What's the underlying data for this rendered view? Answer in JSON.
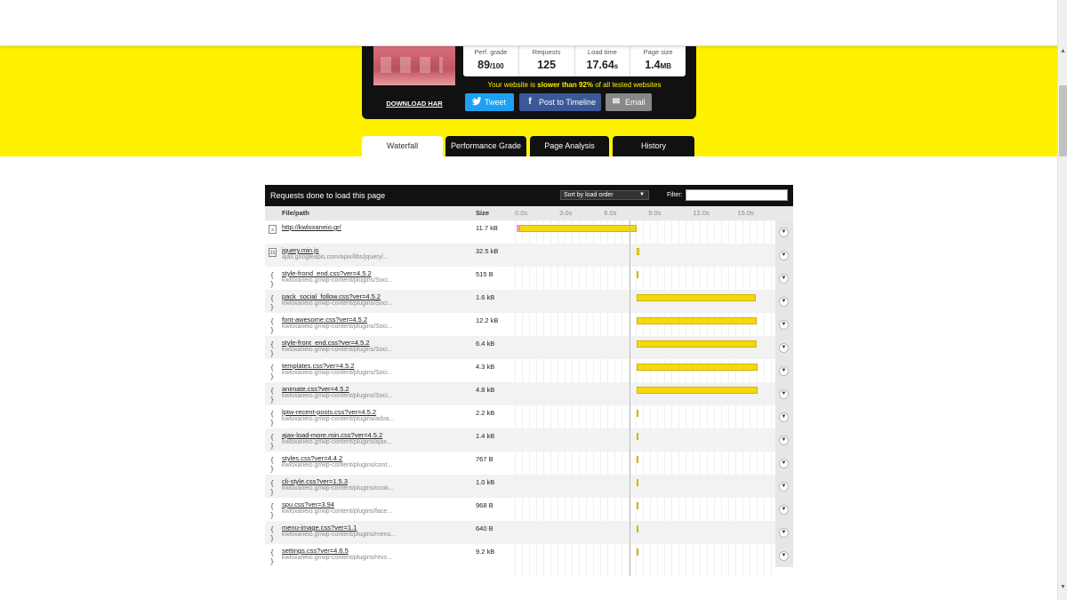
{
  "summary": {
    "download_har": "DOWNLOAD HAR",
    "metrics": [
      {
        "label": "Perf. grade",
        "value": "89",
        "unit": "/100"
      },
      {
        "label": "Requests",
        "value": "125",
        "unit": ""
      },
      {
        "label": "Load time",
        "value": "17.64",
        "unit": "s"
      },
      {
        "label": "Page size",
        "value": "1.4",
        "unit": "MB"
      }
    ],
    "slower_prefix": "Your website is ",
    "slower_bold": "slower than 92%",
    "slower_suffix": " of all tested websites",
    "share": {
      "tweet": "Tweet",
      "facebook": "Post to Timeline",
      "email": "Email"
    }
  },
  "tabs": [
    {
      "label": "Waterfall",
      "active": true
    },
    {
      "label": "Performance Grade",
      "active": false
    },
    {
      "label": "Page Analysis",
      "active": false
    },
    {
      "label": "History",
      "active": false
    }
  ],
  "waterfall": {
    "title": "Requests done to load this page",
    "sort_value": "Sort by load order",
    "filter_label": "Filter:",
    "filter_value": "",
    "col_file": "File/path",
    "col_size": "Size",
    "ticks": [
      {
        "label": "0.0s",
        "t": 0
      },
      {
        "label": "3.0s",
        "t": 3
      },
      {
        "label": "6.0s",
        "t": 6
      },
      {
        "label": "9.0s",
        "t": 9
      },
      {
        "label": "12.0s",
        "t": 12
      },
      {
        "label": "15.0s",
        "t": 15
      }
    ],
    "onload_time": 7.6,
    "rows": [
      {
        "icon": "doc",
        "name": "http://kwloxaneio.gr/",
        "path": "",
        "size": "11.7 kB",
        "start": 0.0,
        "end": 8.1,
        "pre": 0.15
      },
      {
        "icon": "js",
        "name": "jquery.min.js",
        "path": "ajax.googleapis.com/ajax/libs/jquery/...",
        "size": "32.5 kB",
        "start": 8.1,
        "end": 8.25,
        "pre": 0
      },
      {
        "icon": "css",
        "name": "style-frond_end.css?ver=4.5.2",
        "path": "kwloxaneio.gr/wp-content/plugins/Soci...",
        "size": "515 B",
        "start": 8.1,
        "end": 8.2,
        "pre": 0
      },
      {
        "icon": "css",
        "name": "pack_social_follow.css?ver=4.5.2",
        "path": "kwloxaneio.gr/wp-content/plugins/Soci...",
        "size": "1.6 kB",
        "start": 8.1,
        "end": 16.1,
        "pre": 0
      },
      {
        "icon": "css",
        "name": "font-awesome.css?ver=4.5.2",
        "path": "kwloxaneio.gr/wp-content/plugins/Soci...",
        "size": "12.2 kB",
        "start": 8.1,
        "end": 16.15,
        "pre": 0
      },
      {
        "icon": "css",
        "name": "style-front_end.css?ver=4.5.2",
        "path": "kwloxaneio.gr/wp-content/plugins/Soci...",
        "size": "6.4 kB",
        "start": 8.1,
        "end": 16.15,
        "pre": 0
      },
      {
        "icon": "css",
        "name": "templates.css?ver=4.5.2",
        "path": "kwloxaneio.gr/wp-content/plugins/Soci...",
        "size": "4.3 kB",
        "start": 8.1,
        "end": 16.2,
        "pre": 0
      },
      {
        "icon": "css",
        "name": "animate.css?ver=4.5.2",
        "path": "kwloxaneio.gr/wp-content/plugins/Soci...",
        "size": "4.8 kB",
        "start": 8.1,
        "end": 16.2,
        "pre": 0
      },
      {
        "icon": "css",
        "name": "lptw-recent-posts.css?ver=4.5.2",
        "path": "kwloxaneio.gr/wp-content/plugins/adva...",
        "size": "2.2 kB",
        "start": 8.1,
        "end": 8.2,
        "pre": 0
      },
      {
        "icon": "css",
        "name": "ajax-load-more.min.css?ver=4.5.2",
        "path": "kwloxaneio.gr/wp-content/plugins/ajax...",
        "size": "1.4 kB",
        "start": 8.1,
        "end": 8.2,
        "pre": 0
      },
      {
        "icon": "css",
        "name": "styles.css?ver=4.4.2",
        "path": "kwloxaneio.gr/wp-content/plugins/cont...",
        "size": "767 B",
        "start": 8.1,
        "end": 8.2,
        "pre": 0
      },
      {
        "icon": "css",
        "name": "cli-style.css?ver=1.5.3",
        "path": "kwloxaneio.gr/wp-content/plugins/cook...",
        "size": "1.0 kB",
        "start": 8.1,
        "end": 8.2,
        "pre": 0
      },
      {
        "icon": "css",
        "name": "spu.css?ver=3.94",
        "path": "kwloxaneio.gr/wp-content/plugins/face...",
        "size": "968 B",
        "start": 8.1,
        "end": 8.2,
        "pre": 0
      },
      {
        "icon": "css",
        "name": "menu-image.css?ver=1.1",
        "path": "kwloxaneio.gr/wp-content/plugins/menu...",
        "size": "640 B",
        "start": 8.1,
        "end": 8.2,
        "pre": 0
      },
      {
        "icon": "css",
        "name": "settings.css?ver=4.6.5",
        "path": "kwloxaneio.gr/wp-content/plugins/revs...",
        "size": "9.2 kB",
        "start": 8.1,
        "end": 8.2,
        "pre": 0
      }
    ]
  }
}
